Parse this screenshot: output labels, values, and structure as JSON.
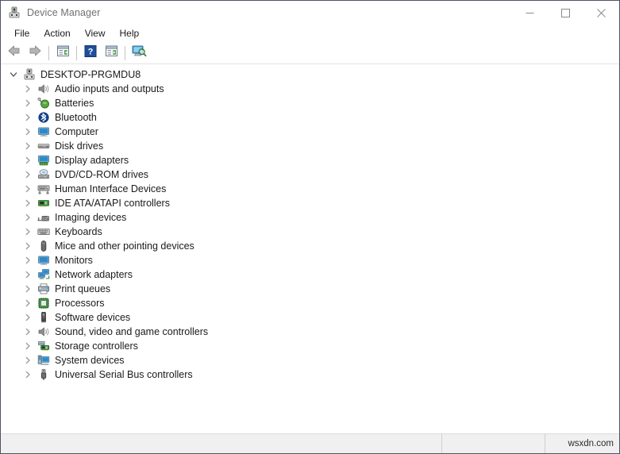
{
  "window": {
    "title": "Device Manager",
    "title_icon": "device-manager-icon",
    "controls": {
      "minimize": "minimize-icon",
      "maximize": "maximize-icon",
      "close": "close-icon"
    }
  },
  "menubar": {
    "items": [
      {
        "label": "File"
      },
      {
        "label": "Action"
      },
      {
        "label": "View"
      },
      {
        "label": "Help"
      }
    ]
  },
  "toolbar": {
    "buttons": [
      {
        "name": "back-icon",
        "type": "icon"
      },
      {
        "name": "forward-icon",
        "type": "icon"
      },
      {
        "name": "separator",
        "type": "separator"
      },
      {
        "name": "properties-icon",
        "type": "icon"
      },
      {
        "name": "separator",
        "type": "separator"
      },
      {
        "name": "help-icon",
        "type": "icon"
      },
      {
        "name": "show-hidden-devices-icon",
        "type": "icon"
      },
      {
        "name": "separator",
        "type": "separator"
      },
      {
        "name": "scan-for-hardware-changes-icon",
        "type": "icon"
      }
    ]
  },
  "tree": {
    "root": {
      "label": "DESKTOP-PRGMDU8",
      "icon": "computer-root-icon",
      "expanded": true
    },
    "items": [
      {
        "label": "Audio inputs and outputs",
        "icon": "speaker-icon",
        "expanded": false
      },
      {
        "label": "Batteries",
        "icon": "battery-icon",
        "expanded": false
      },
      {
        "label": "Bluetooth",
        "icon": "bluetooth-icon",
        "expanded": false
      },
      {
        "label": "Computer",
        "icon": "monitor-icon",
        "expanded": false
      },
      {
        "label": "Disk drives",
        "icon": "disk-drive-icon",
        "expanded": false
      },
      {
        "label": "Display adapters",
        "icon": "display-adapter-icon",
        "expanded": false
      },
      {
        "label": "DVD/CD-ROM drives",
        "icon": "dvd-drive-icon",
        "expanded": false
      },
      {
        "label": "Human Interface Devices",
        "icon": "hid-icon",
        "expanded": false
      },
      {
        "label": "IDE ATA/ATAPI controllers",
        "icon": "ide-controller-icon",
        "expanded": false
      },
      {
        "label": "Imaging devices",
        "icon": "imaging-device-icon",
        "expanded": false
      },
      {
        "label": "Keyboards",
        "icon": "keyboard-icon",
        "expanded": false
      },
      {
        "label": "Mice and other pointing devices",
        "icon": "mouse-icon",
        "expanded": false
      },
      {
        "label": "Monitors",
        "icon": "monitor-icon",
        "expanded": false
      },
      {
        "label": "Network adapters",
        "icon": "network-adapter-icon",
        "expanded": false
      },
      {
        "label": "Print queues",
        "icon": "printer-icon",
        "expanded": false
      },
      {
        "label": "Processors",
        "icon": "processor-icon",
        "expanded": false
      },
      {
        "label": "Software devices",
        "icon": "software-device-icon",
        "expanded": false
      },
      {
        "label": "Sound, video and game controllers",
        "icon": "speaker-icon",
        "expanded": false
      },
      {
        "label": "Storage controllers",
        "icon": "storage-controller-icon",
        "expanded": false
      },
      {
        "label": "System devices",
        "icon": "system-device-icon",
        "expanded": false
      },
      {
        "label": "Universal Serial Bus controllers",
        "icon": "usb-icon",
        "expanded": false
      }
    ]
  },
  "statusbar": {
    "main_text": "",
    "middle_text": "",
    "watermark": "wsxdn.com"
  },
  "colors": {
    "window_border": "#4c5463",
    "title_text": "#707070",
    "body_text": "#1a1a1a",
    "statusbar_bg": "#f0f0f0",
    "accent_blue": "#1f5fa9",
    "icon_green": "#3c8c3c"
  }
}
